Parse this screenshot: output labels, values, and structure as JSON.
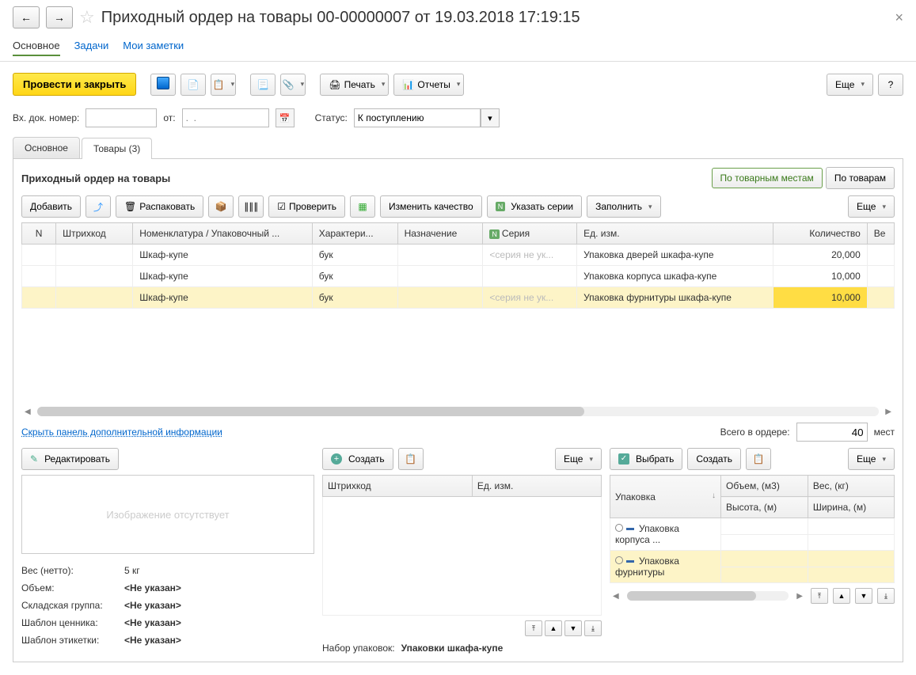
{
  "header": {
    "title": "Приходный ордер на товары 00-00000007 от 19.03.2018 17:19:15"
  },
  "topTabs": {
    "main": "Основное",
    "tasks": "Задачи",
    "notes": "Мои заметки"
  },
  "toolbar": {
    "post": "Провести и закрыть",
    "print": "Печать",
    "reports": "Отчеты",
    "more": "Еще",
    "help": "?"
  },
  "form": {
    "docNumLabel": "Вх. док. номер:",
    "fromLabel": "от:",
    "datePlaceholder": ".  .",
    "statusLabel": "Статус:",
    "statusValue": "К поступлению"
  },
  "subTabs": {
    "main": "Основное",
    "goods": "Товары (3)"
  },
  "goodsPanel": {
    "title": "Приходный ордер на товары",
    "byPlaces": "По товарным местам",
    "byGoods": "По товарам",
    "add": "Добавить",
    "unpack": "Распаковать",
    "check": "Проверить",
    "changeQuality": "Изменить качество",
    "setSeries": "Указать серии",
    "fill": "Заполнить",
    "more": "Еще"
  },
  "goodsCols": {
    "n": "N",
    "barcode": "Штрихкод",
    "nomenclature": "Номенклатура / Упаковочный ...",
    "char": "Характери...",
    "purpose": "Назначение",
    "series": "Серия",
    "unit": "Ед. изм.",
    "qty": "Количество",
    "weight": "Ве"
  },
  "goodsRows": [
    {
      "nom": "Шкаф-купе",
      "char": "бук",
      "series": "<серия не ук...",
      "unit": "Упаковка дверей шкафа-купе",
      "qty": "20,000"
    },
    {
      "nom": "Шкаф-купе",
      "char": "бук",
      "series": "",
      "unit": "Упаковка корпуса шкафа-купе",
      "qty": "10,000"
    },
    {
      "nom": "Шкаф-купе",
      "char": "бук",
      "series": "<серия не ук...",
      "unit": "Упаковка фурнитуры шкафа-купе",
      "qty": "10,000"
    }
  ],
  "hideLink": "Скрыть панель дополнительной информации",
  "total": {
    "label": "Всего в ордере:",
    "value": "40",
    "unit": "мест"
  },
  "leftPanel": {
    "edit": "Редактировать",
    "noImage": "Изображение отсутствует",
    "weightLabel": "Вес (нетто):",
    "weightVal": "5 кг",
    "volumeLabel": "Объем:",
    "notSet": "<Не указан>",
    "groupLabel": "Складская группа:",
    "priceTplLabel": "Шаблон ценника:",
    "labelTplLabel": "Шаблон этикетки:"
  },
  "midPanel": {
    "create": "Создать",
    "more": "Еще",
    "barcode": "Штрихкод",
    "unit": "Ед. изм.",
    "packSetLabel": "Набор упаковок:",
    "packSetVal": "Упаковки шкафа-купе"
  },
  "rightPanel": {
    "choose": "Выбрать",
    "create": "Создать",
    "more": "Еще",
    "pack": "Упаковка",
    "volume": "Объем, (м3)",
    "weight": "Вес, (кг)",
    "height": "Высота, (м)",
    "width": "Ширина, (м)",
    "rows": [
      {
        "name": "Упаковка корпуса ..."
      },
      {
        "name": "Упаковка фурнитуры"
      }
    ]
  }
}
